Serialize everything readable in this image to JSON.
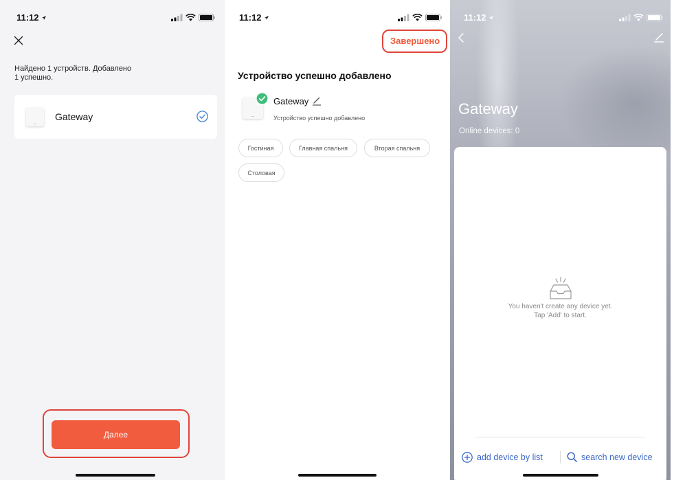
{
  "screen1": {
    "status": {
      "time": "11:12"
    },
    "message_lines": [
      "Найдено 1 устройств. Добавлено",
      "1 успешно."
    ],
    "device": {
      "name": "Gateway",
      "icon": "gateway-device-icon",
      "status_icon": "check-circle-icon"
    },
    "next_button": "Далее"
  },
  "screen2": {
    "status": {
      "time": "11:12"
    },
    "done_button": "Завершено",
    "title": "Устройство успешно добавлено",
    "device": {
      "name": "Gateway",
      "subtitle": "Устройство успешно добавлено",
      "badge_icon": "success-check-icon",
      "edit_icon": "pencil-icon"
    },
    "rooms": [
      "Гостиная",
      "Главная спальня",
      "Вторая спальня",
      "Столовая"
    ]
  },
  "screen3": {
    "status": {
      "time": "11:12"
    },
    "title": "Gateway",
    "online_devices": "Online devices: 0",
    "empty_state": [
      "You haven't create any device yet.",
      "Tap 'Add' to start."
    ],
    "actions": {
      "add_by_list": "add device by list",
      "search_new": "search new device"
    }
  },
  "colors": {
    "accent": "#f25c3e",
    "highlight_outline": "#e0443a",
    "check_blue": "#3d7fd9",
    "success_green": "#3cbf79",
    "link_blue": "#3a67c7"
  }
}
